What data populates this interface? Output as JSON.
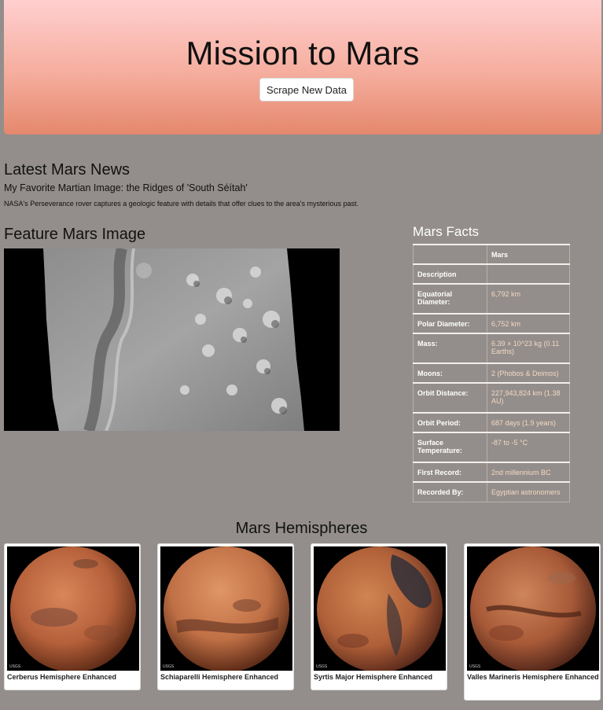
{
  "header": {
    "title": "Mission to Mars",
    "scrape_button": "Scrape New Data"
  },
  "news": {
    "section_title": "Latest Mars News",
    "headline": "My Favorite Martian Image: the Ridges of 'South Séítah'",
    "teaser": "NASA's Perseverance rover captures a geologic feature with details that offer clues to the area's mysterious past."
  },
  "feature": {
    "section_title": "Feature Mars Image"
  },
  "facts": {
    "section_title": "Mars Facts",
    "header_blank": "",
    "header_col": "Mars",
    "rows": [
      {
        "key": "Description",
        "value": ""
      },
      {
        "key": "Equatorial Diameter:",
        "value": "6,792 km"
      },
      {
        "key": "Polar Diameter:",
        "value": "6,752 km"
      },
      {
        "key": "Mass:",
        "value": "6.39 × 10^23 kg (0.11 Earths)"
      },
      {
        "key": "Moons:",
        "value": "2 (Phobos & Deimos)"
      },
      {
        "key": "Orbit Distance:",
        "value": "227,943,824 km (1.38 AU)"
      },
      {
        "key": "Orbit Period:",
        "value": "687 days (1.9 years)"
      },
      {
        "key": "Surface Temperature:",
        "value": "-87 to -5 °C"
      },
      {
        "key": "First Record:",
        "value": "2nd millennium BC"
      },
      {
        "key": "Recorded By:",
        "value": "Egyptian astronomers"
      }
    ]
  },
  "hemispheres": {
    "section_title": "Mars Hemispheres",
    "items": [
      {
        "title": "Cerberus Hemisphere Enhanced"
      },
      {
        "title": "Schiaparelli Hemisphere Enhanced"
      },
      {
        "title": "Syrtis Major Hemisphere Enhanced"
      },
      {
        "title": "Valles Marineris Hemisphere Enhanced"
      }
    ],
    "badge": "USGS"
  },
  "colors": {
    "page_background": "#938e8b",
    "jumbotron_top": "#ffcfcf",
    "jumbotron_bottom": "#e5886d",
    "facts_value_text": "#f4d8c3"
  }
}
